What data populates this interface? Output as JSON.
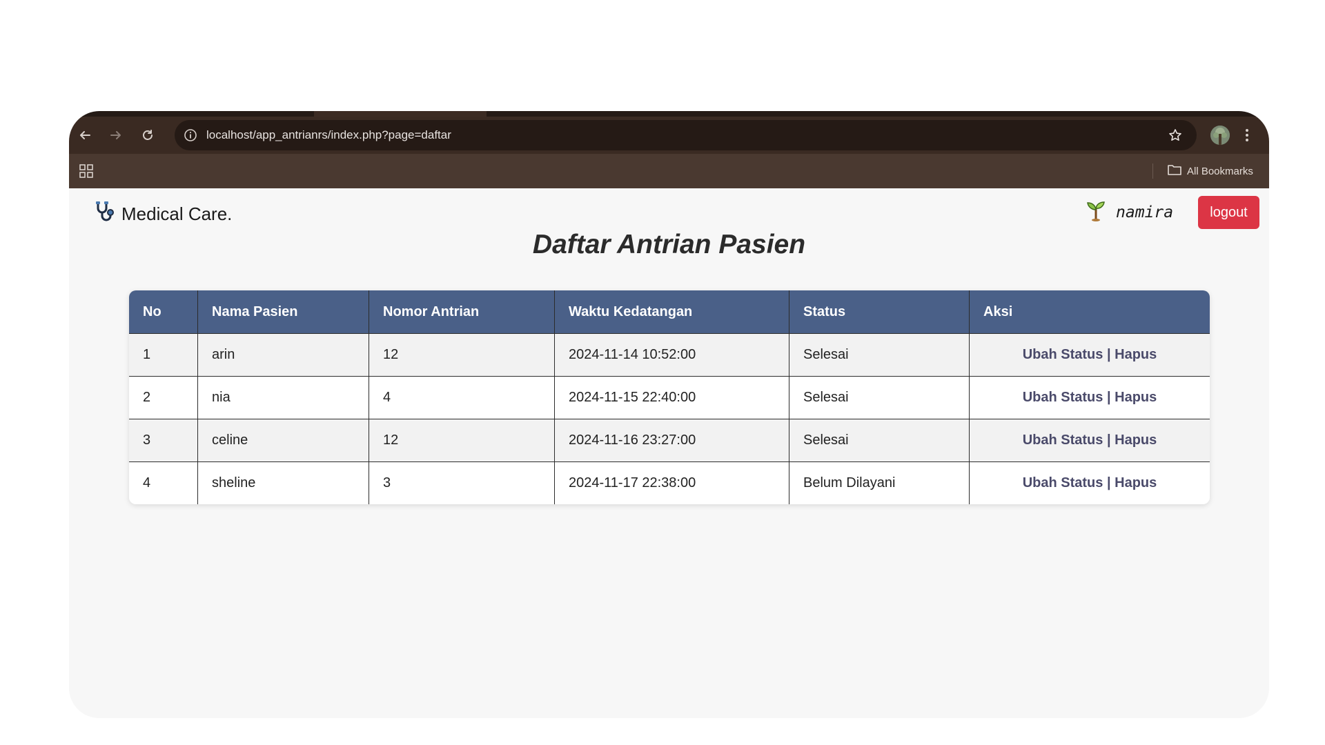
{
  "browser": {
    "url": "localhost/app_antrianrs/index.php?page=daftar",
    "all_bookmarks_label": "All Bookmarks",
    "icons": {
      "back": "back-arrow-icon",
      "forward": "forward-arrow-icon",
      "reload": "reload-icon",
      "site_info": "info-icon",
      "bookmark_star": "star-icon",
      "profile": "profile-avatar",
      "menu": "kebab-menu-icon",
      "apps": "apps-grid-icon",
      "folder": "folder-icon"
    }
  },
  "header": {
    "brand": "Medical Care.",
    "brand_icon": "stethoscope-icon",
    "username": "namira",
    "user_icon": "sprout-icon",
    "logout_label": "logout"
  },
  "title": "Daftar Antrian Pasien",
  "table": {
    "headers": [
      "No",
      "Nama Pasien",
      "Nomor Antrian",
      "Waktu Kedatangan",
      "Status",
      "Aksi"
    ],
    "rows": [
      {
        "no": "1",
        "nama": "arin",
        "nomor": "12",
        "waktu": "2024-11-14 10:52:00",
        "status": "Selesai",
        "ubah": "Ubah Status",
        "sep": "|",
        "hapus": "Hapus"
      },
      {
        "no": "2",
        "nama": "nia",
        "nomor": "4",
        "waktu": "2024-11-15 22:40:00",
        "status": "Selesai",
        "ubah": "Ubah Status",
        "sep": "|",
        "hapus": "Hapus"
      },
      {
        "no": "3",
        "nama": "celine",
        "nomor": "12",
        "waktu": "2024-11-16 23:27:00",
        "status": "Selesai",
        "ubah": "Ubah Status",
        "sep": "|",
        "hapus": "Hapus"
      },
      {
        "no": "4",
        "nama": "sheline",
        "nomor": "3",
        "waktu": "2024-11-17 22:38:00",
        "status": "Belum Dilayani",
        "ubah": "Ubah Status",
        "sep": "|",
        "hapus": "Hapus"
      }
    ]
  },
  "colors": {
    "header_bg": "#4a6088",
    "logout_bg": "#dc3545",
    "chrome_toolbar": "#3a2a22",
    "chrome_bookmarks": "#4a3930",
    "link": "#4a4a6a"
  }
}
